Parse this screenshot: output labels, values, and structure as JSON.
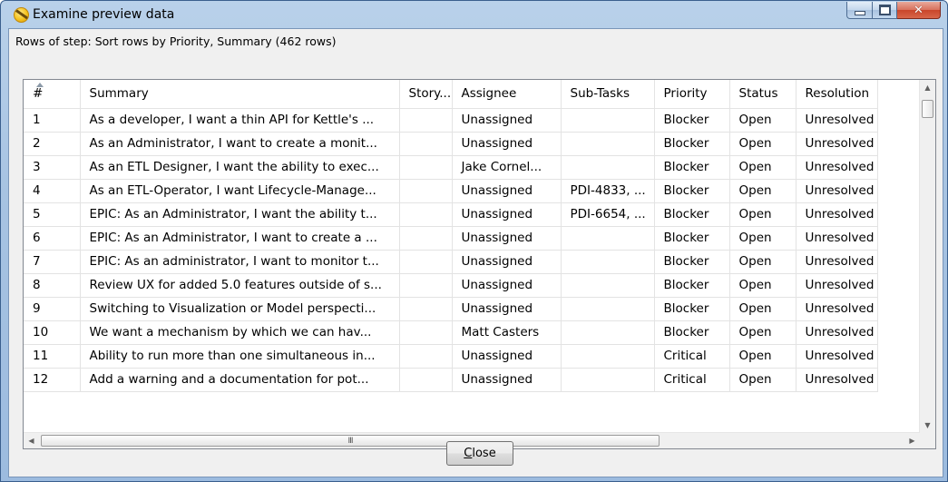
{
  "window": {
    "title": "Examine preview data",
    "icon": "kettle-icon"
  },
  "step_label": "Rows of step: Sort rows by Priority, Summary (462 rows)",
  "table": {
    "columns": [
      "#",
      "Summary",
      "Story...",
      "Assignee",
      "Sub-Tasks",
      "Priority",
      "Status",
      "Resolution"
    ],
    "rows": [
      [
        "1",
        "As a developer, I want a thin API for Kettle's ...",
        "",
        "Unassigned",
        "",
        "Blocker",
        "Open",
        "Unresolved"
      ],
      [
        "2",
        "As an Administrator, I want to create a monit...",
        "",
        "Unassigned",
        "",
        "Blocker",
        "Open",
        "Unresolved"
      ],
      [
        "3",
        "As an ETL Designer, I want the ability to exec...",
        "",
        "Jake Cornel...",
        "",
        "Blocker",
        "Open",
        "Unresolved"
      ],
      [
        "4",
        "As an ETL-Operator, I want Lifecycle-Manage...",
        "",
        "Unassigned",
        "PDI-4833, ...",
        "Blocker",
        "Open",
        "Unresolved"
      ],
      [
        "5",
        "EPIC: As an Administrator, I want the ability t...",
        "",
        "Unassigned",
        "PDI-6654, ...",
        "Blocker",
        "Open",
        "Unresolved"
      ],
      [
        "6",
        "EPIC: As an Administrator, I want to create a ...",
        "",
        "Unassigned",
        "",
        "Blocker",
        "Open",
        "Unresolved"
      ],
      [
        "7",
        "EPIC: As an administrator, I want to monitor t...",
        "",
        "Unassigned",
        "",
        "Blocker",
        "Open",
        "Unresolved"
      ],
      [
        "8",
        "Review UX for added 5.0 features outside of s...",
        "",
        "Unassigned",
        "",
        "Blocker",
        "Open",
        "Unresolved"
      ],
      [
        "9",
        "Switching to Visualization or Model perspecti...",
        "",
        "Unassigned",
        "",
        "Blocker",
        "Open",
        "Unresolved"
      ],
      [
        "10",
        "We want a mechanism by which we can hav...",
        "",
        "Matt Casters",
        "",
        "Blocker",
        "Open",
        "Unresolved"
      ],
      [
        "11",
        "Ability to run more than one simultaneous in...",
        "",
        "Unassigned",
        "",
        "Critical",
        "Open",
        "Unresolved"
      ],
      [
        "12",
        "Add a warning and a documentation for pot...",
        "",
        "Unassigned",
        "",
        "Critical",
        "Open",
        "Unresolved"
      ]
    ]
  },
  "scrollbar": {
    "hscroll_grip": "III"
  },
  "buttons": {
    "close_label": "Close",
    "close_mnemonic": "C",
    "close_rest": "lose"
  }
}
